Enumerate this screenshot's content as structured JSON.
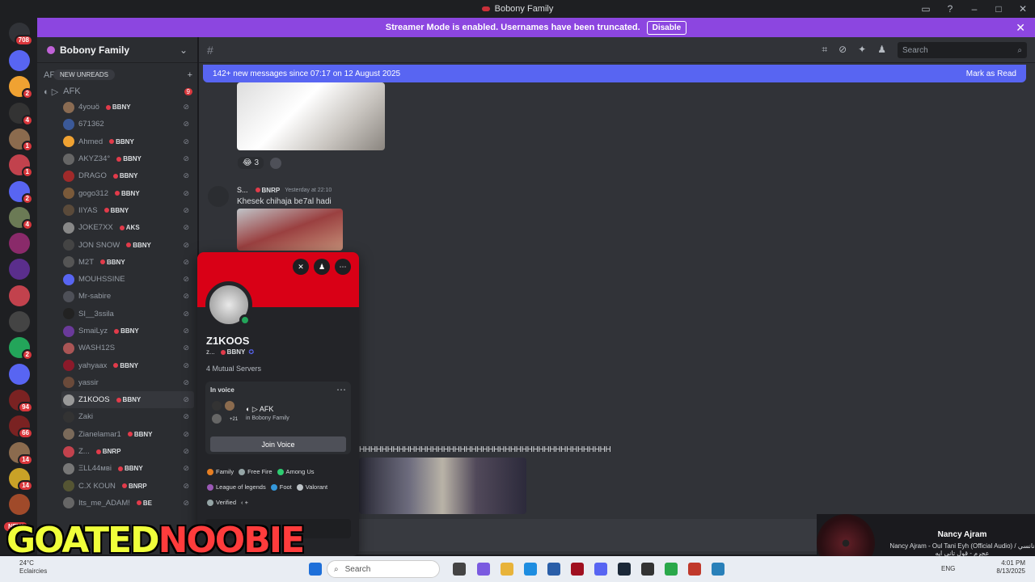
{
  "window": {
    "title": "Bobony Family"
  },
  "banner": {
    "text": "Streamer Mode is enabled. Usernames have been truncated.",
    "disable": "Disable"
  },
  "servers": {
    "top_badge": "708",
    "items": [
      {
        "badge": "",
        "color": "#5865f2"
      },
      {
        "badge": "2",
        "color": "#f0a232"
      },
      {
        "badge": "4",
        "color": "#333"
      },
      {
        "badge": "1",
        "color": "#8b6b4e"
      },
      {
        "badge": "1",
        "color": "#c2424d"
      },
      {
        "badge": "2",
        "color": "#5865f2"
      },
      {
        "badge": "4",
        "color": "#6b7a55"
      },
      {
        "badge": "",
        "color": "#8a2a6a"
      },
      {
        "badge": "",
        "color": "#5a2e8c"
      },
      {
        "badge": "",
        "color": "#c2424d"
      },
      {
        "badge": "",
        "color": "#444"
      },
      {
        "badge": "2",
        "color": "#23a55a"
      },
      {
        "badge": "",
        "color": "#5865f2"
      },
      {
        "badge": "94",
        "color": "#7a2222"
      },
      {
        "badge": "66",
        "color": "#7a2222"
      },
      {
        "badge": "14",
        "color": "#8b6b4e"
      },
      {
        "badge": "14",
        "color": "#c9a227"
      },
      {
        "badge": "",
        "color": "#a04a2a"
      }
    ],
    "new_label": "NEW"
  },
  "sidebar": {
    "guild_name": "Bobony Family",
    "channel": {
      "label": "AF",
      "ping": "9"
    },
    "new_unreads": "NEW UNREADS",
    "voice_channel": "AFK",
    "members": [
      {
        "name": "4youö",
        "tag": "BBNY",
        "av": "#8a6b52"
      },
      {
        "name": "671362",
        "tag": "",
        "av": "#3b5998"
      },
      {
        "name": "Ahmed",
        "tag": "BBNY",
        "av": "#f0a232"
      },
      {
        "name": "AKYZ34°",
        "tag": "BBNY",
        "av": "#666"
      },
      {
        "name": "DRAGO",
        "tag": "BBNY",
        "av": "#a02a2a"
      },
      {
        "name": "gogo312",
        "tag": "BBNY",
        "av": "#7a5a3a"
      },
      {
        "name": "IIYAS",
        "tag": "BBNY",
        "av": "#5a4a3a"
      },
      {
        "name": "JOKE7XX",
        "tag": "AKS",
        "av": "#888"
      },
      {
        "name": "JON SNOW",
        "tag": "BBNY",
        "av": "#444"
      },
      {
        "name": "M2T",
        "tag": "BBNY",
        "av": "#555"
      },
      {
        "name": "MOUHSSINE",
        "tag": "",
        "av": "#5865f2"
      },
      {
        "name": "Mr-sabire",
        "tag": "",
        "av": "#4e5058"
      },
      {
        "name": "SI__3ssila",
        "tag": "",
        "av": "#222"
      },
      {
        "name": "SmaiLyz",
        "tag": "BBNY",
        "av": "#6a3a9a"
      },
      {
        "name": "WASH12S",
        "tag": "",
        "av": "#a55"
      },
      {
        "name": "yahyaax",
        "tag": "BBNY",
        "av": "#8b1a2a"
      },
      {
        "name": "yassir",
        "tag": "",
        "av": "#6a4a3a"
      },
      {
        "name": "Z1KOOS",
        "tag": "BBNY",
        "av": "#999",
        "selected": true
      },
      {
        "name": "Zaki",
        "tag": "",
        "av": "#333"
      },
      {
        "name": "Zianelamar1",
        "tag": "BBNY",
        "av": "#7a6a5a"
      },
      {
        "name": "Z...",
        "tag": "BNRP",
        "av": "#c2424d"
      },
      {
        "name": "ΞLL44мві",
        "tag": "BBNY",
        "av": "#777"
      },
      {
        "name": "C.X KOUN",
        "tag": "BNRP",
        "av": "#553"
      },
      {
        "name": "Its_me_ADAM!",
        "tag": "BE",
        "av": "#666"
      }
    ]
  },
  "header": {
    "search_placeholder": "Search"
  },
  "chat": {
    "new_messages": "142+ new messages since 07:17 on 12 August 2025",
    "mark_as_read": "Mark as Read",
    "reaction_count": "3",
    "msg_author": "S...",
    "msg_tag": "BNRP",
    "msg_time": "Yesterday at 22:10",
    "msg_text": "Khesek chihaja be7al hadi",
    "long_text": "HHHHHHHHHHHHHHHHHHHHHHHHHHHHHHHHHHHHHHHHHHHHH"
  },
  "profile": {
    "name": "Z1KOOS",
    "sub": "z...",
    "sub_tag": "BBNY",
    "mutual": "4 Mutual Servers",
    "in_voice": "In voice",
    "voice_channel": "AFK",
    "voice_server": "in Bobony Family",
    "voice_extra": "+21",
    "join": "Join Voice",
    "roles": [
      {
        "name": "Family",
        "color": "#e67e22"
      },
      {
        "name": "Free Fire",
        "color": "#95a5a6"
      },
      {
        "name": "Among Us",
        "color": "#2ecc71"
      },
      {
        "name": "League of legends",
        "color": "#9b59b6"
      },
      {
        "name": "Foot",
        "color": "#3498db"
      },
      {
        "name": "Valorant",
        "color": "#bdc3c7"
      },
      {
        "name": "Verified",
        "color": "#95a5a6"
      }
    ]
  },
  "music": {
    "artist": "Nancy Ajram",
    "track": "Nancy Ajram - Oul Tani Eyh (Official Audio) / نانسي عجرم - قول تاني ايه"
  },
  "overlay": {
    "part1": "GOATED",
    "part2": "NOOBIE"
  },
  "taskbar": {
    "temp": "24°C",
    "weather": "Eclaircies",
    "search": "Search",
    "lang": "ENG",
    "time": "4:01 PM",
    "date": "8/13/2025"
  }
}
